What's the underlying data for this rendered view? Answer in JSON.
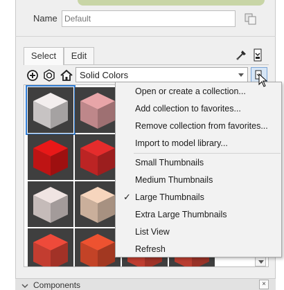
{
  "name_field": {
    "label": "Name",
    "placeholder": "Default"
  },
  "tabs": [
    {
      "label": "Select",
      "active": true
    },
    {
      "label": "Edit",
      "active": false
    }
  ],
  "library_select": {
    "value": "Solid Colors"
  },
  "thumbnails": [
    {
      "color": "#f3eeee",
      "selected": true
    },
    {
      "color": "#e8a5a8",
      "selected": false
    },
    {
      "color": "#ffffff",
      "selected": false
    },
    {
      "color": "#ffffff",
      "selected": false
    },
    {
      "color": "#ffffff",
      "selected": false
    },
    {
      "color": "#e81818",
      "selected": false
    },
    {
      "color": "#e52c2c",
      "selected": false
    },
    {
      "color": "#ffffff",
      "selected": false
    },
    {
      "color": "#ffffff",
      "selected": false
    },
    {
      "color": "#ffffff",
      "selected": false
    },
    {
      "color": "#f0e4e2",
      "selected": false
    },
    {
      "color": "#f6d5bd",
      "selected": false
    },
    {
      "color": "#ffffff",
      "selected": false
    },
    {
      "color": "#ffffff",
      "selected": false
    },
    {
      "color": "#ffffff",
      "selected": false
    },
    {
      "color": "#ee4a3a",
      "selected": false
    },
    {
      "color": "#ee5230",
      "selected": false
    },
    {
      "color": "#e84a3a",
      "selected": false
    },
    {
      "color": "#e04a3a",
      "selected": false
    },
    {
      "color": "#ffffff",
      "selected": false
    }
  ],
  "menu": {
    "group1": [
      "Open or create a collection...",
      "Add collection to favorites...",
      "Remove collection from favorites...",
      "Import to model library..."
    ],
    "group2": [
      {
        "label": "Small Thumbnails",
        "checked": false
      },
      {
        "label": "Medium Thumbnails",
        "checked": false
      },
      {
        "label": "Large Thumbnails",
        "checked": true
      },
      {
        "label": "Extra Large Thumbnails",
        "checked": false
      },
      {
        "label": "List View",
        "checked": false
      },
      {
        "label": "Refresh",
        "checked": false
      }
    ],
    "check_glyph": "✓"
  },
  "components_bar": {
    "label": "Components",
    "close": "×"
  },
  "icons": [
    "copy-icon",
    "eyedropper-icon",
    "details-icon",
    "add-icon",
    "model-icon",
    "home-icon",
    "secondary-pane-icon",
    "chevron-down-icon",
    "mouse-cursor-icon"
  ],
  "colors": {
    "accent": "#2e7bd3",
    "selection_button": "#d7e6f6"
  }
}
